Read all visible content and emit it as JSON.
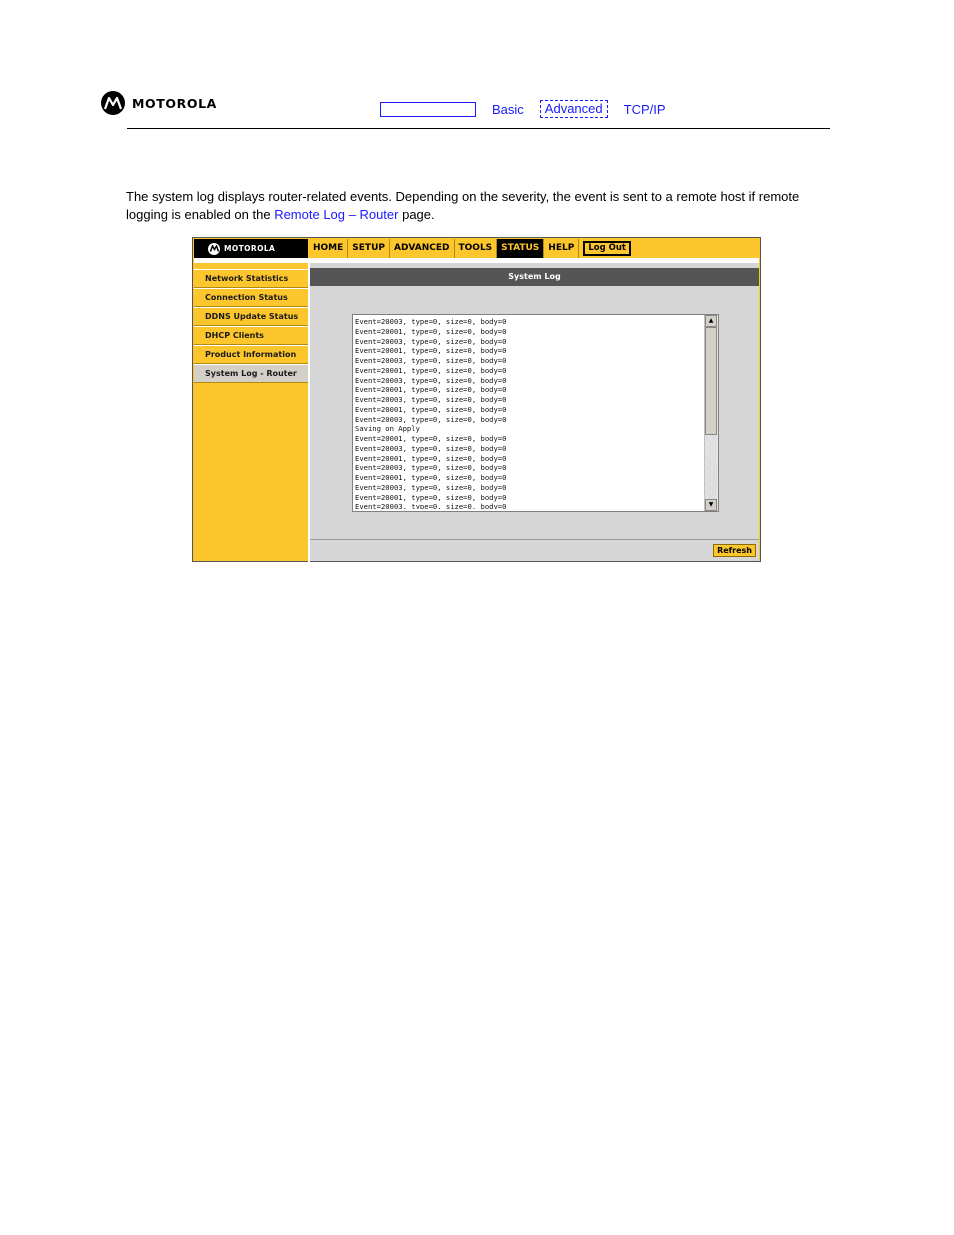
{
  "doc_header": {
    "logo_text": "MOTOROLA",
    "nav": {
      "basic": "Basic",
      "advanced": "Advanced",
      "tcpip": "TCP/IP"
    }
  },
  "intro": {
    "text_before": "The system log displays router-related events. Depending on the severity, the event is sent to a remote host if remote logging is enabled on the ",
    "link": "Remote Log – Router",
    "text_after": " page."
  },
  "router_ui": {
    "logo_text": "MOTOROLA",
    "top_nav": [
      "HOME",
      "SETUP",
      "ADVANCED",
      "TOOLS",
      "STATUS",
      "HELP"
    ],
    "active_tab": "STATUS",
    "logout_label": "Log Out",
    "sidebar": [
      "Network Statistics",
      "Connection Status",
      "DDNS Update Status",
      "DHCP Clients",
      "Product Information",
      "System Log - Router"
    ],
    "active_sidebar": "System Log - Router",
    "page_title": "System Log",
    "log_lines": [
      "Event=20003, type=0, size=0, body=0",
      "Event=20001, type=0, size=0, body=0",
      "Event=20003, type=0, size=0, body=0",
      "Event=20001, type=0, size=0, body=0",
      "Event=20003, type=0, size=0, body=0",
      "Event=20001, type=0, size=0, body=0",
      "Event=20003, type=0, size=0, body=0",
      "Event=20001, type=0, size=0, body=0",
      "Event=20003, type=0, size=0, body=0",
      "Event=20001, type=0, size=0, body=0",
      "Event=20003, type=0, size=0, body=0",
      "Saving on Apply",
      "Event=20001, type=0, size=0, body=0",
      "Event=20003, type=0, size=0, body=0",
      "Event=20001, type=0, size=0, body=0",
      "Event=20003, type=0, size=0, body=0",
      "Event=20001, type=0, size=0, body=0",
      "Event=20003, type=0, size=0, body=0",
      "Event=20001, type=0, size=0, body=0",
      "Event=20003, type=0, size=0, body=0"
    ],
    "refresh_label": "Refresh"
  },
  "colors": {
    "accent_yellow": "#fdc62c",
    "link_blue": "#1a1aff",
    "title_bar": "#555555"
  }
}
